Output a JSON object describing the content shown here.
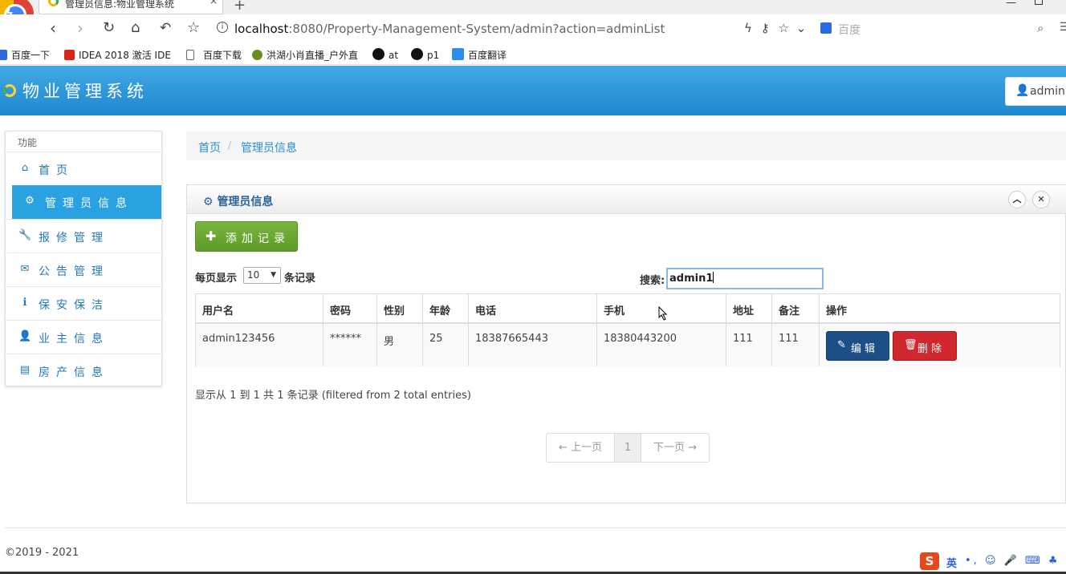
{
  "browser": {
    "tab_title": "管理员信息:物业管理系统",
    "tab_close": "×",
    "new_tab": "+",
    "url_host": "localhost",
    "url_rest": ":8080/Property-Management-System/admin?action=adminList",
    "search_placeholder": "百度",
    "bookmarks": [
      {
        "label": "百度一下",
        "icon": "baidu-icon",
        "color": "#2d6ae0"
      },
      {
        "label": "IDEA 2018 激活 IDE",
        "icon": "idea-icon",
        "color": "#d9261c"
      },
      {
        "label": "百度下载",
        "icon": "page-icon",
        "color": "#ffffff"
      },
      {
        "label": "洪湖小肖直播_户外直",
        "icon": "bird-icon",
        "color": "#6b8e23"
      },
      {
        "label": "at",
        "icon": "github-icon",
        "color": "#111111"
      },
      {
        "label": "p1",
        "icon": "github-icon",
        "color": "#111111"
      },
      {
        "label": "百度翻译",
        "icon": "translate-icon",
        "color": "#2d8cf0"
      }
    ]
  },
  "app": {
    "title": "物业管理系统",
    "user": "admin",
    "colors": {
      "header": "#2a96d8",
      "active": "#2aa1e1",
      "link": "#2679b5",
      "add": "#6aa834",
      "edit": "#1c4e87",
      "delete": "#d1282f"
    }
  },
  "sidebar": {
    "heading": "功能",
    "items": [
      {
        "label": "首页",
        "icon": "home-icon"
      },
      {
        "label": "管理员信息",
        "icon": "gear-icon",
        "active": true
      },
      {
        "label": "报修管理",
        "icon": "wrench-icon"
      },
      {
        "label": "公告管理",
        "icon": "envelope-icon"
      },
      {
        "label": "保安保洁",
        "icon": "info-icon"
      },
      {
        "label": "业主信息",
        "icon": "user-icon"
      },
      {
        "label": "房产信息",
        "icon": "list-icon"
      }
    ]
  },
  "breadcrumb": [
    "首页",
    "管理员信息"
  ],
  "panel": {
    "title": "管理员信息",
    "add_button": "添加记录",
    "length_prefix": "每页显示",
    "length_value": "10",
    "length_suffix": "条记录",
    "search_label": "搜索:",
    "search_value": "admin1"
  },
  "table": {
    "columns": [
      "用户名",
      "密码",
      "性别",
      "年龄",
      "电话",
      "手机",
      "地址",
      "备注",
      "操作"
    ],
    "rows": [
      {
        "username": "admin123456",
        "password": "******",
        "gender": "男",
        "age": "25",
        "phone": "18387665443",
        "mobile": "18380443200",
        "address": "111",
        "remark": "111",
        "edit": "编辑",
        "delete": "删除"
      }
    ]
  },
  "info": "显示从 1 到 1 共 1 条记录 (filtered from 2 total entries)",
  "pagination": {
    "prev": "← 上一页",
    "current": "1",
    "next": "下一页 →"
  },
  "footer": "©2019 - 2021",
  "ime": {
    "lang": "英"
  }
}
